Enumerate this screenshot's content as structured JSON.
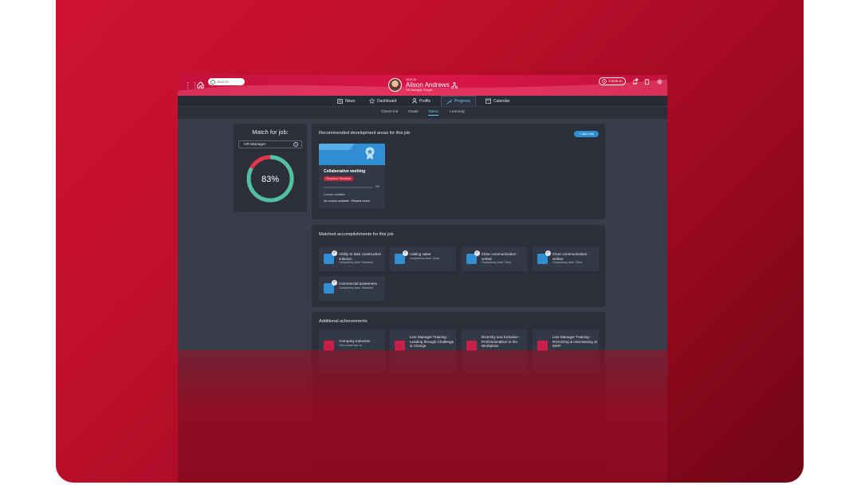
{
  "header": {
    "search_placeholder": "Search",
    "user_id": "000128",
    "user_name": "Alison Andrews",
    "user_role": "HR Manager, People",
    "clockin_label": "Clock-in",
    "notification_count": "1"
  },
  "nav": {
    "items": [
      {
        "label": "News",
        "icon": "news-icon"
      },
      {
        "label": "Dashboard",
        "icon": "star-icon"
      },
      {
        "label": "Profile",
        "icon": "person-icon"
      },
      {
        "label": "Progress",
        "icon": "progress-icon",
        "active": true
      },
      {
        "label": "Calendar",
        "icon": "calendar-icon"
      }
    ]
  },
  "subnav": {
    "items": [
      {
        "label": "Check-ins"
      },
      {
        "label": "Goals"
      },
      {
        "label": "Talent",
        "active": true
      },
      {
        "label": "Learning"
      }
    ]
  },
  "match": {
    "title": "Match for job:",
    "job": "HR Manager",
    "percent": 83,
    "percent_label": "83%",
    "colors": {
      "good": "#4fc3a1",
      "bad": "#e0364f"
    }
  },
  "development": {
    "title": "Recommended development areas for this job",
    "add_new_label": "+ Add new",
    "card": {
      "title": "Collaborative working",
      "badge": "Required: Standard",
      "progress": 0,
      "progress_label": "0%",
      "meta": "Courses available",
      "meta2": "No courses available - Request course"
    }
  },
  "accomplishments": {
    "title": "Matched accomplishments for this job",
    "items": [
      {
        "title": "Ability to take constructive criticism",
        "level": "Competency level: Standard"
      },
      {
        "title": "Adding value",
        "level": "Competency level: Good"
      },
      {
        "title": "Clear communication - verbal",
        "level": "Competency level: Good"
      },
      {
        "title": "Clear communication - written",
        "level": "Competency level: Good"
      },
      {
        "title": "Commercial awareness",
        "level": "Competency level: Standard"
      }
    ]
  },
  "achievements": {
    "title": "Additional achievements",
    "items": [
      {
        "title": "Company Induction",
        "sub": "This course has no"
      },
      {
        "title": "Line Manager Training - Leading through Challenge & Change",
        "sub": ""
      },
      {
        "title": "Diversity and Inclusion - Professionalism in the Workplace",
        "sub": ""
      },
      {
        "title": "Line Manager Training - Recruiting & Interviewing at MHR",
        "sub": ""
      }
    ]
  }
}
